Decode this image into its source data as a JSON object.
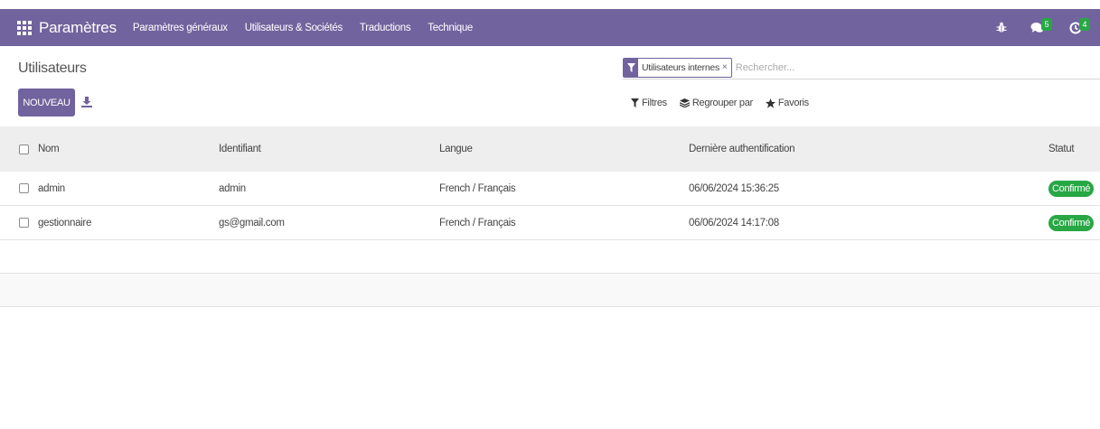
{
  "navbar": {
    "app_name": "Paramètres",
    "menu": [
      "Paramètres généraux",
      "Utilisateurs & Sociétés",
      "Traductions",
      "Technique"
    ],
    "messages_count": "5",
    "activities_count": "4"
  },
  "page": {
    "title": "Utilisateurs",
    "new_button": "NOUVEAU"
  },
  "search": {
    "facet_label": "Utilisateurs internes",
    "facet_remove": "×",
    "placeholder": "Rechercher..."
  },
  "filters": {
    "filters_label": "Filtres",
    "group_by_label": "Regrouper par",
    "favorites_label": "Favoris"
  },
  "table": {
    "headers": {
      "name": "Nom",
      "login": "Identifiant",
      "language": "Langue",
      "last_auth": "Dernière authentification",
      "status": "Statut"
    },
    "rows": [
      {
        "name": "admin",
        "login": "admin",
        "language": "French / Français",
        "last_auth": "06/06/2024 15:36:25",
        "status": "Confirmé"
      },
      {
        "name": "gestionnaire",
        "login": "gs@gmail.com",
        "language": "French / Français",
        "last_auth": "06/06/2024 14:17:08",
        "status": "Confirmé"
      }
    ]
  },
  "colors": {
    "brand": "#71639e",
    "status_confirmed": "#28a745"
  }
}
